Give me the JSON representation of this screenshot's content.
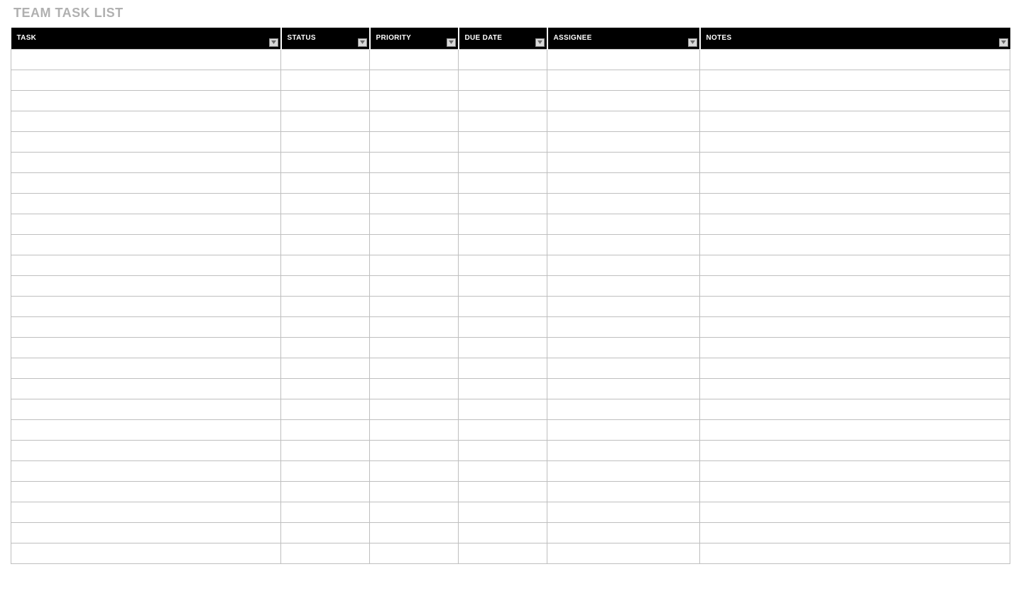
{
  "title": "TEAM TASK LIST",
  "columns": [
    {
      "key": "task",
      "label": "TASK",
      "filterable": true
    },
    {
      "key": "status",
      "label": "STATUS",
      "filterable": true
    },
    {
      "key": "priority",
      "label": "PRIORITY",
      "filterable": true
    },
    {
      "key": "due_date",
      "label": "DUE DATE",
      "filterable": true
    },
    {
      "key": "assignee",
      "label": "ASSIGNEE",
      "filterable": true
    },
    {
      "key": "notes",
      "label": "NOTES",
      "filterable": true
    }
  ],
  "rows": [
    {
      "task": "",
      "status": "",
      "priority": "",
      "due_date": "",
      "assignee": "",
      "notes": ""
    },
    {
      "task": "",
      "status": "",
      "priority": "",
      "due_date": "",
      "assignee": "",
      "notes": ""
    },
    {
      "task": "",
      "status": "",
      "priority": "",
      "due_date": "",
      "assignee": "",
      "notes": ""
    },
    {
      "task": "",
      "status": "",
      "priority": "",
      "due_date": "",
      "assignee": "",
      "notes": ""
    },
    {
      "task": "",
      "status": "",
      "priority": "",
      "due_date": "",
      "assignee": "",
      "notes": ""
    },
    {
      "task": "",
      "status": "",
      "priority": "",
      "due_date": "",
      "assignee": "",
      "notes": ""
    },
    {
      "task": "",
      "status": "",
      "priority": "",
      "due_date": "",
      "assignee": "",
      "notes": ""
    },
    {
      "task": "",
      "status": "",
      "priority": "",
      "due_date": "",
      "assignee": "",
      "notes": ""
    },
    {
      "task": "",
      "status": "",
      "priority": "",
      "due_date": "",
      "assignee": "",
      "notes": ""
    },
    {
      "task": "",
      "status": "",
      "priority": "",
      "due_date": "",
      "assignee": "",
      "notes": ""
    },
    {
      "task": "",
      "status": "",
      "priority": "",
      "due_date": "",
      "assignee": "",
      "notes": ""
    },
    {
      "task": "",
      "status": "",
      "priority": "",
      "due_date": "",
      "assignee": "",
      "notes": ""
    },
    {
      "task": "",
      "status": "",
      "priority": "",
      "due_date": "",
      "assignee": "",
      "notes": ""
    },
    {
      "task": "",
      "status": "",
      "priority": "",
      "due_date": "",
      "assignee": "",
      "notes": ""
    },
    {
      "task": "",
      "status": "",
      "priority": "",
      "due_date": "",
      "assignee": "",
      "notes": ""
    },
    {
      "task": "",
      "status": "",
      "priority": "",
      "due_date": "",
      "assignee": "",
      "notes": ""
    },
    {
      "task": "",
      "status": "",
      "priority": "",
      "due_date": "",
      "assignee": "",
      "notes": ""
    },
    {
      "task": "",
      "status": "",
      "priority": "",
      "due_date": "",
      "assignee": "",
      "notes": ""
    },
    {
      "task": "",
      "status": "",
      "priority": "",
      "due_date": "",
      "assignee": "",
      "notes": ""
    },
    {
      "task": "",
      "status": "",
      "priority": "",
      "due_date": "",
      "assignee": "",
      "notes": ""
    },
    {
      "task": "",
      "status": "",
      "priority": "",
      "due_date": "",
      "assignee": "",
      "notes": ""
    },
    {
      "task": "",
      "status": "",
      "priority": "",
      "due_date": "",
      "assignee": "",
      "notes": ""
    },
    {
      "task": "",
      "status": "",
      "priority": "",
      "due_date": "",
      "assignee": "",
      "notes": ""
    },
    {
      "task": "",
      "status": "",
      "priority": "",
      "due_date": "",
      "assignee": "",
      "notes": ""
    },
    {
      "task": "",
      "status": "",
      "priority": "",
      "due_date": "",
      "assignee": "",
      "notes": ""
    }
  ]
}
